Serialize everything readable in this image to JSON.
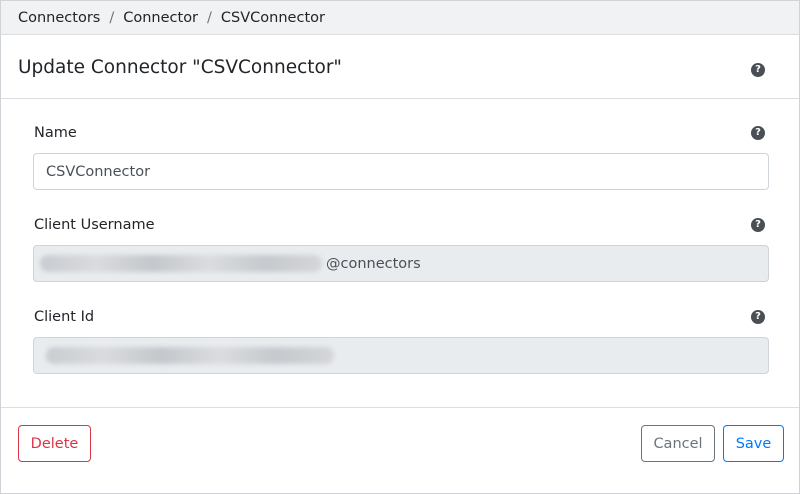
{
  "breadcrumb": {
    "items": [
      "Connectors",
      "Connector",
      "CSVConnector"
    ],
    "separator": "/"
  },
  "header": {
    "title": "Update Connector \"CSVConnector\"",
    "help_icon": "question-circle-icon"
  },
  "form": {
    "name": {
      "label": "Name",
      "value": "CSVConnector"
    },
    "client_username": {
      "label": "Client Username",
      "value_suffix": "@connectors"
    },
    "client_id": {
      "label": "Client Id"
    }
  },
  "footer": {
    "delete_label": "Delete",
    "cancel_label": "Cancel",
    "save_label": "Save"
  },
  "colors": {
    "danger": "#dc3545",
    "secondary": "#6c757d",
    "primary": "#007bff",
    "readonly_bg": "#e9ecef",
    "breadcrumb_bg": "#f1f2f3"
  }
}
